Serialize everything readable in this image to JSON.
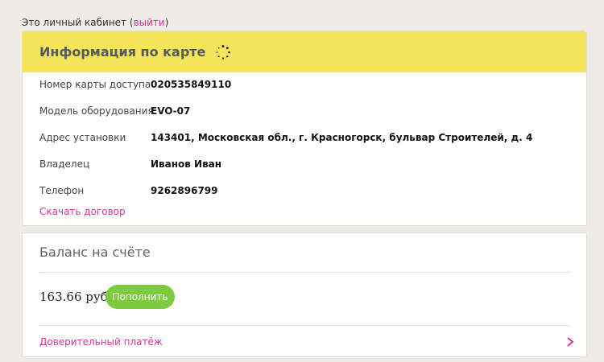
{
  "greeting": {
    "text": "Это личный кабинет",
    "open_paren": "(",
    "logout_label": "выйти",
    "close_paren": ")"
  },
  "card_info": {
    "title": "Информация по карте",
    "rows": [
      {
        "label": "Номер карты доступа",
        "value": "020535849110"
      },
      {
        "label": "Модель оборудования",
        "value": "EVO-07"
      },
      {
        "label": "Адрес установки",
        "value": "143401, Московская обл., г. Красногорск, бульвар Строителей, д. 4"
      },
      {
        "label": "Владелец",
        "value": "Иванов Иван"
      },
      {
        "label": "Телефон",
        "value": "9262896799"
      }
    ],
    "contract_link": "Скачать договор"
  },
  "balance": {
    "title": "Баланс на счёте",
    "amount": "163.66 руб.",
    "topup_label": "Пополнить",
    "trust_payment_link": "Доверительный платёж"
  },
  "colors": {
    "accent_pink": "#d6339a",
    "header_yellow": "#f4e45a",
    "button_green": "#7dcb3e",
    "background": "#efebe5"
  },
  "icons": {
    "loading": "spinner-icon",
    "chevron": "chevron-right-icon"
  }
}
